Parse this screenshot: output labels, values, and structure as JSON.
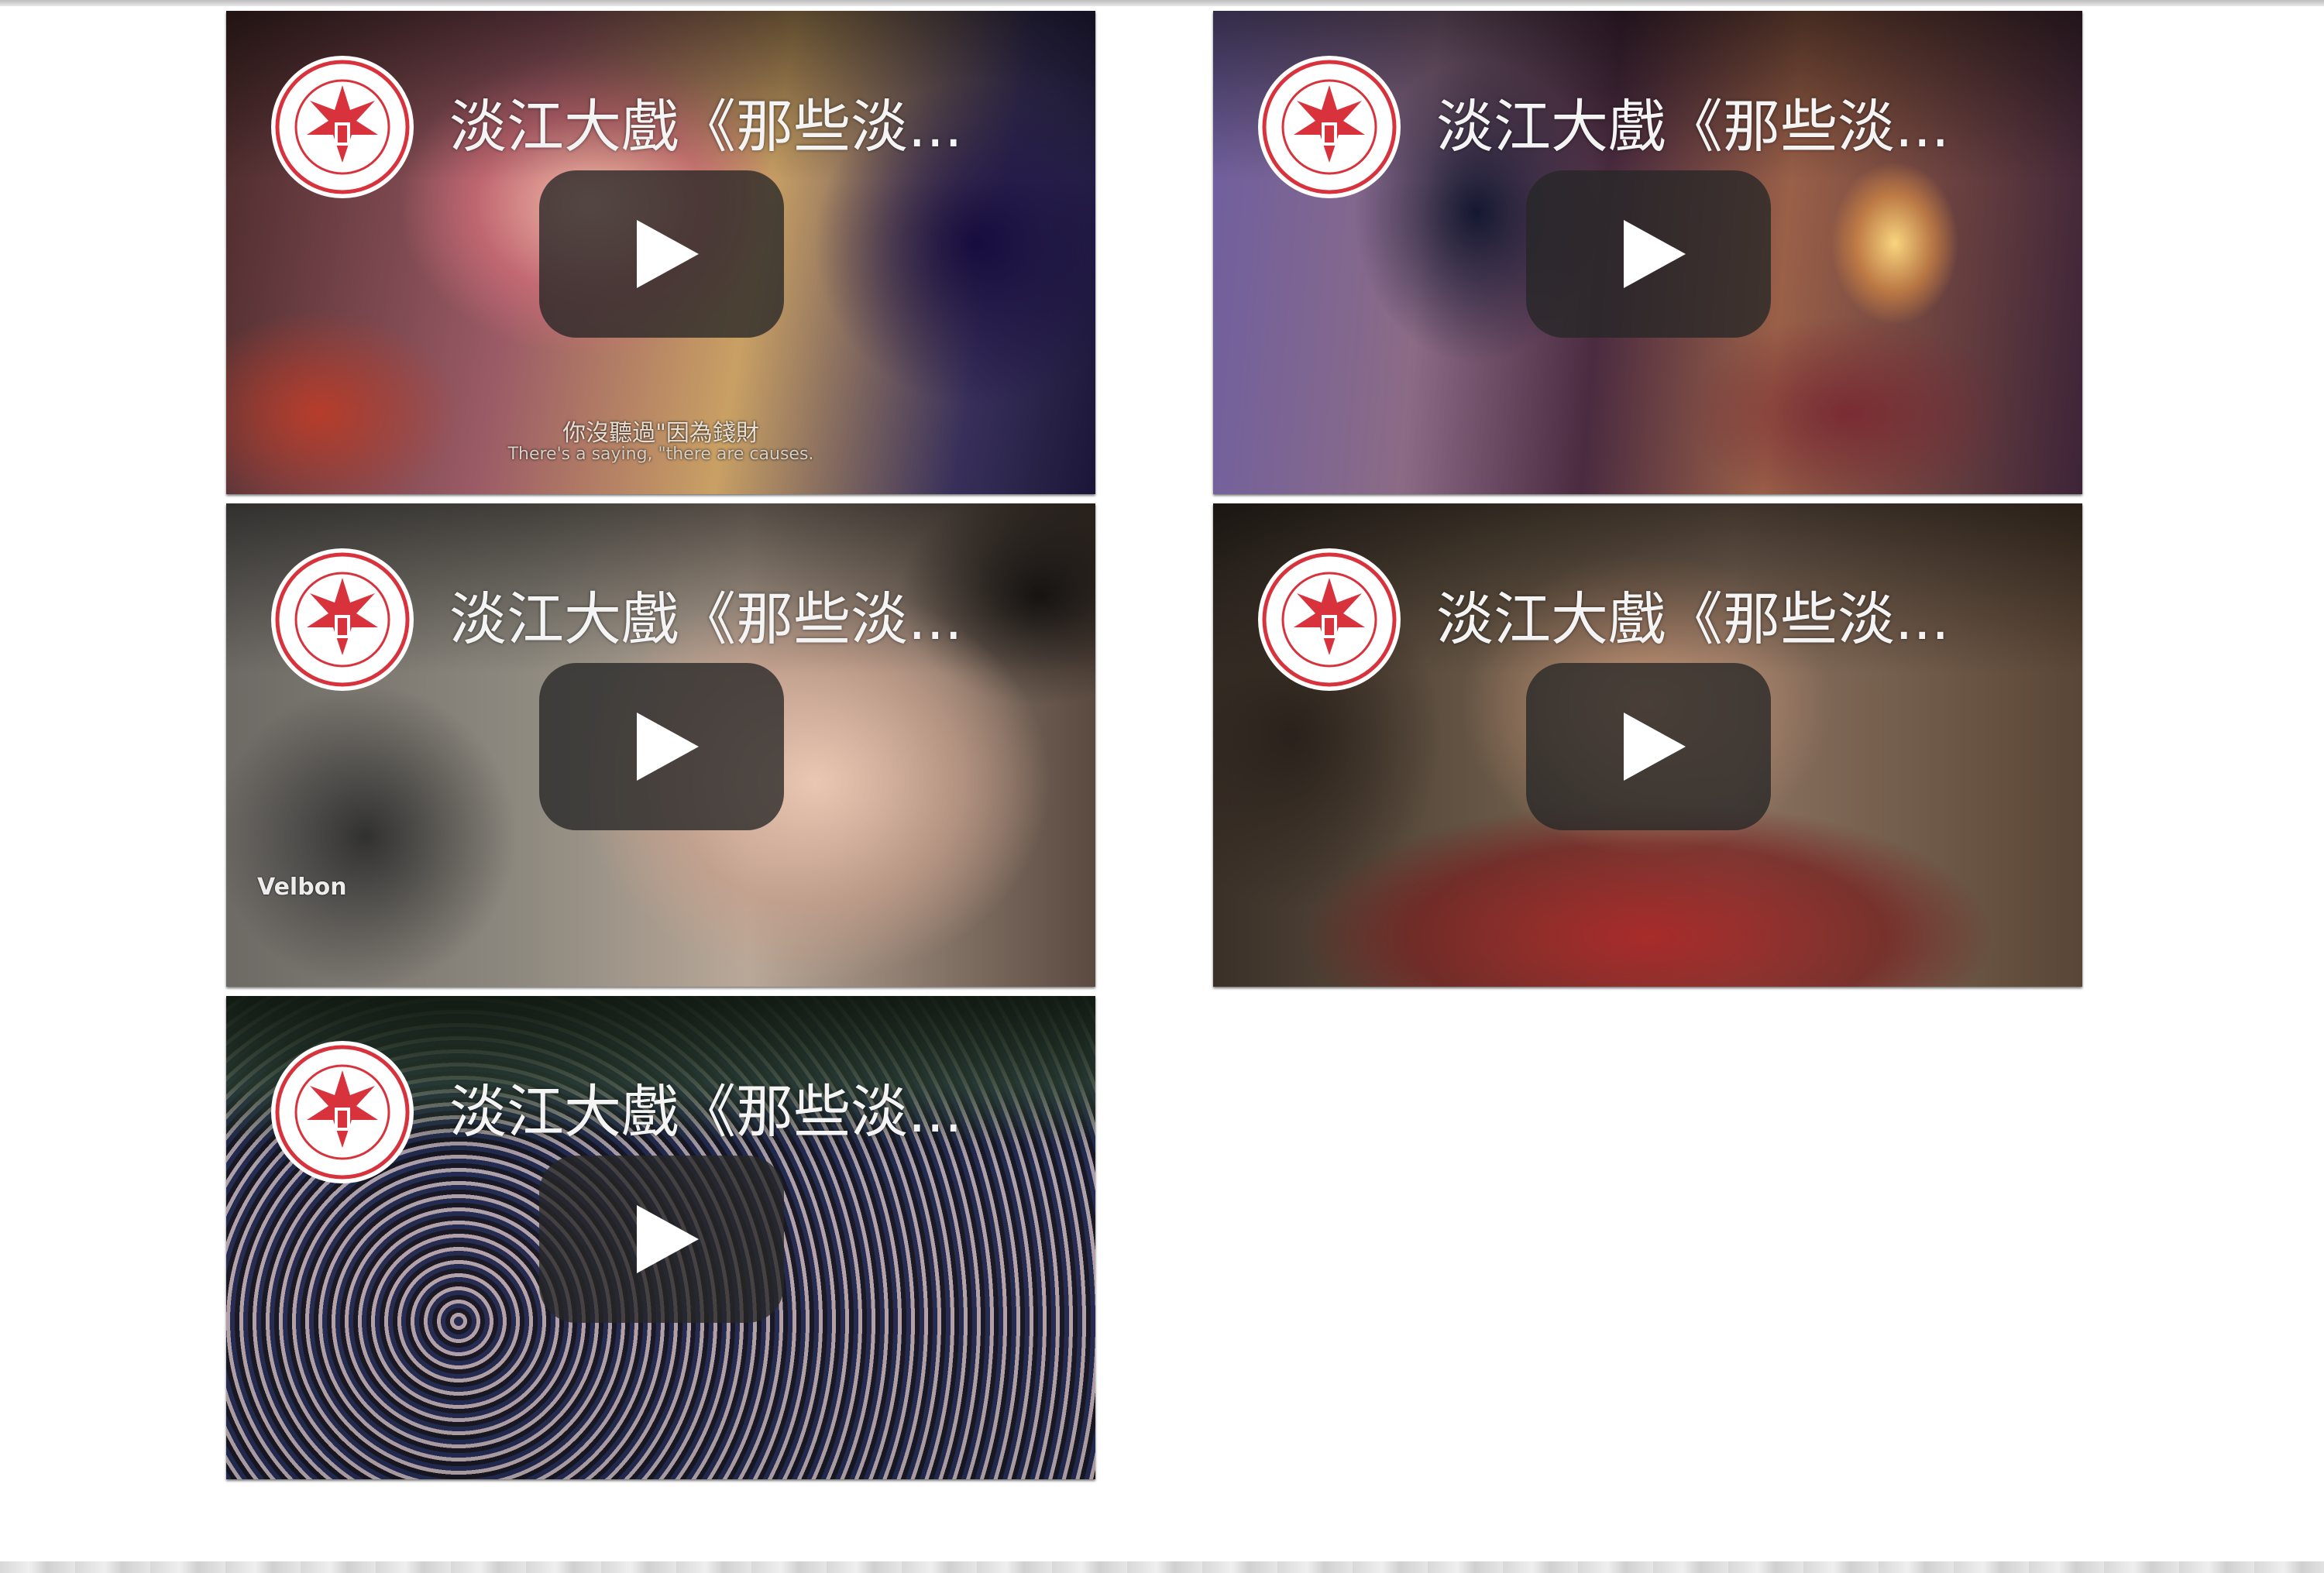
{
  "videos": [
    {
      "title": "淡江大戲《那些淡...",
      "subtitle_cn": "你沒聽過\"因為錢財",
      "subtitle_en": "There's a saying, \"there are causes."
    },
    {
      "title": "淡江大戲《那些淡..."
    },
    {
      "title": "淡江大戲《那些淡...",
      "camera_brand": "Velbon"
    },
    {
      "title": "淡江大戲《那些淡..."
    },
    {
      "title": "淡江大戲《那些淡..."
    }
  ],
  "colors": {
    "seal_red": "#d8333c",
    "play_button_bg": "#262626",
    "title_text": "#f4f4f4"
  },
  "icons": {
    "play": "play-triangle-icon",
    "channel": "university-seal-logo"
  }
}
